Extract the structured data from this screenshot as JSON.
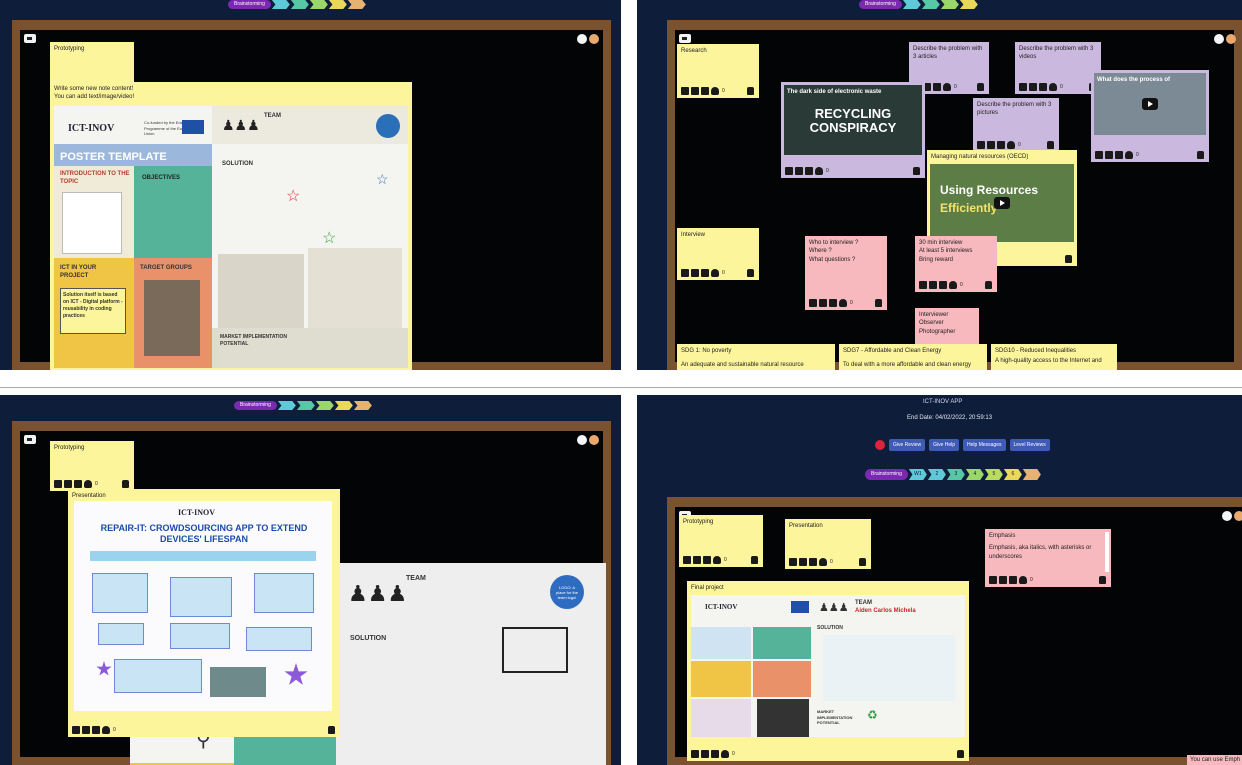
{
  "tl": {
    "note_prototyping": "Prototyping",
    "note_new_line1": "Write some new note content!",
    "note_new_line2": "You can add text/image/video!",
    "poster_logo": "ICT-INOV",
    "poster_eu": "Co-funded by the Erasmus+ Programme of the European Union",
    "poster_title": "POSTER TEMPLATE",
    "poster_intro": "INTRODUCTION TO THE TOPIC",
    "poster_objectives": "OBJECTIVES",
    "poster_team": "TEAM",
    "poster_solution": "SOLUTION",
    "poster_ict": "ICT IN YOUR PROJECT",
    "poster_ict_body": "Solution itself is based on ICT - Digital platform - reusability in coding practices",
    "poster_target": "TARGET GROUPS",
    "poster_market": "MARKET IMPLEMENTATION POTENTIAL"
  },
  "tr": {
    "research": "Research",
    "describe_articles": "Describe the problem with 3 articles",
    "describe_videos": "Describe the problem with 3 videos",
    "describe_pictures": "Describe the problem with 3 pictures",
    "video1_title": "The dark side of electronic waste",
    "video1_big": "RECYCLING CONSPIRACY",
    "video2_title": "What does the process of",
    "managing": "Managing natural resources (OECD)",
    "video3_big1": "Using Resources",
    "video3_big2": "Efficiently",
    "interview": "Interview",
    "who_line1": "Who to interview ?",
    "who_line2": "Where ?",
    "who_line3": "What questions ?",
    "min_line1": "30 min interview",
    "min_line2": "At least 5 interviews",
    "min_line3": "Bring reward",
    "roles_line1": "Interviewer",
    "roles_line2": "Observer",
    "roles_line3": "Photographer",
    "sdg1_title": "SDG 1: No poverty",
    "sdg1_body": "An adequate and sustainable natural resource",
    "sdg7_title": "SDG7 - Affordable and Clean Energy",
    "sdg7_body": "To deal with a more affordable and clean energy",
    "sdg10_title": "SDG10 - Reduced Inequalities",
    "sdg10_body": "A high-quality access to the Internet and"
  },
  "bl": {
    "prototyping": "Prototyping",
    "presentation": "Presentation",
    "logo": "ICT-INOV",
    "repair_title": "REPAIR-IT: CROWDSOURCING APP TO EXTEND DEVICES' LIFESPAN",
    "team": "TEAM",
    "solution": "SOLUTION",
    "logo_circle": "LOGO: A place for the team logo!"
  },
  "br": {
    "app_name": "ICT-INOV APP",
    "end_date": "End Date: 04/02/2022, 20:59:13",
    "buttons": [
      "Give Review",
      "Give Help",
      "Help Messages",
      "Level Reviews"
    ],
    "stage": "Brainstorming",
    "steps": [
      "W1",
      "2",
      "3",
      "4",
      "5",
      "6"
    ],
    "prototyping": "Prototyping",
    "presentation": "Presentation",
    "emphasis_title": "Emphasis",
    "emphasis_body": "Emphasis, aka italics, with asterisks or underscores",
    "final_project": "Final project",
    "logo": "ICT-INOV",
    "team": "TEAM",
    "names": "Aiden Carlos Michela",
    "solution": "SOLUTION",
    "market": "MARKET IMPLEMENTATION POTENTIAL",
    "corner_text": "You can use Emph"
  },
  "stage_label": "Brainstorming",
  "counts": "0"
}
